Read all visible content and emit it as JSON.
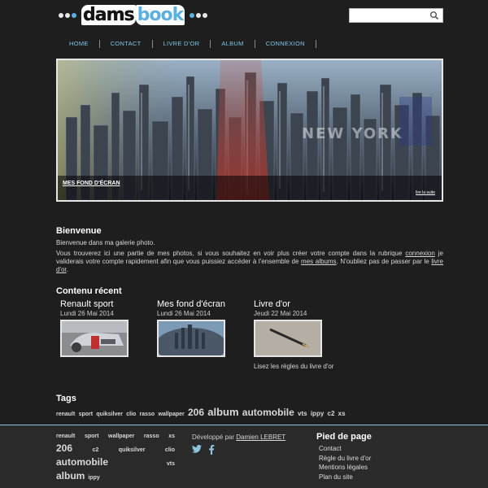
{
  "header": {
    "logo_part1": "dams",
    "logo_part2": "book",
    "search_placeholder": "",
    "colors": {
      "dot_light": "#e8e8e8",
      "dot_blue": "#5bb0e0",
      "dot_grey": "#9a9a9a"
    }
  },
  "nav": {
    "items": [
      "HOME",
      "CONTACT",
      "LIVRE D'OR",
      "ALBUM",
      "CONNEXION"
    ],
    "color": "#7fc6e8"
  },
  "banner": {
    "title": "MES FOND D'ÉCRAN",
    "more_label": "lire la suite",
    "overlay_text": "NEW YORK"
  },
  "welcome": {
    "title": "Bienvenue",
    "intro": "Bienvenue dans ma galerie photo.",
    "text_part1": "Vous trouverez ici une partie de mes photos, si vous souhaitez en voir plus créer votre compte dans la rubrique ",
    "link_connexion": "connexion",
    "text_part2": " je validerais votre compte rapidement afin que vous puissiez accéder à l'ensemble de ",
    "link_albums": "mes albums",
    "text_part3": ". N'oubliez pas de passer par le ",
    "link_livre": "livre d'or",
    "text_part4": "."
  },
  "recent": {
    "title": "Contenu récent",
    "items": [
      {
        "title": "Renault sport",
        "date": "Lundi 26 Mai 2014",
        "description": "",
        "thumb_icon": "car-photo-icon"
      },
      {
        "title": "Mes fond d'écran",
        "date": "Lundi 26 Mai 2014",
        "description": "",
        "thumb_icon": "city-photo-icon"
      },
      {
        "title": "Livre d'or",
        "date": "Jeudi 22 Mai 2014",
        "description": "Lisez les règles du livre d'or",
        "thumb_icon": "pen-photo-icon"
      }
    ]
  },
  "tags": {
    "title": "Tags",
    "items": [
      {
        "label": "renault",
        "size": "s"
      },
      {
        "label": "sport",
        "size": "s"
      },
      {
        "label": "quiksilver",
        "size": "s"
      },
      {
        "label": "clio",
        "size": "s"
      },
      {
        "label": "rasso",
        "size": "s"
      },
      {
        "label": "wallpaper",
        "size": "s"
      },
      {
        "label": "206",
        "size": "l"
      },
      {
        "label": "album",
        "size": "xl"
      },
      {
        "label": "automobile",
        "size": "l"
      },
      {
        "label": "vts",
        "size": "m"
      },
      {
        "label": "ippy",
        "size": "m"
      },
      {
        "label": "c2",
        "size": "m"
      },
      {
        "label": "xs",
        "size": "m"
      }
    ]
  },
  "footer": {
    "tags": {
      "row1": [
        "renault",
        "sport",
        "wallpaper",
        "rasso",
        "xs"
      ],
      "row2": [
        "206",
        "c2",
        "quiksilver",
        "clio"
      ],
      "row3": [
        "automobile",
        "vts"
      ],
      "row4": [
        "album",
        "ippy"
      ]
    },
    "dev_label": "Développé par",
    "dev_name": "Damien LEBRET",
    "links_title": "Pied de page",
    "links": [
      "Contact",
      "Règle du livre d'or",
      "Mentions légales",
      "Plan du site"
    ],
    "accent": "#8ec3e0"
  }
}
